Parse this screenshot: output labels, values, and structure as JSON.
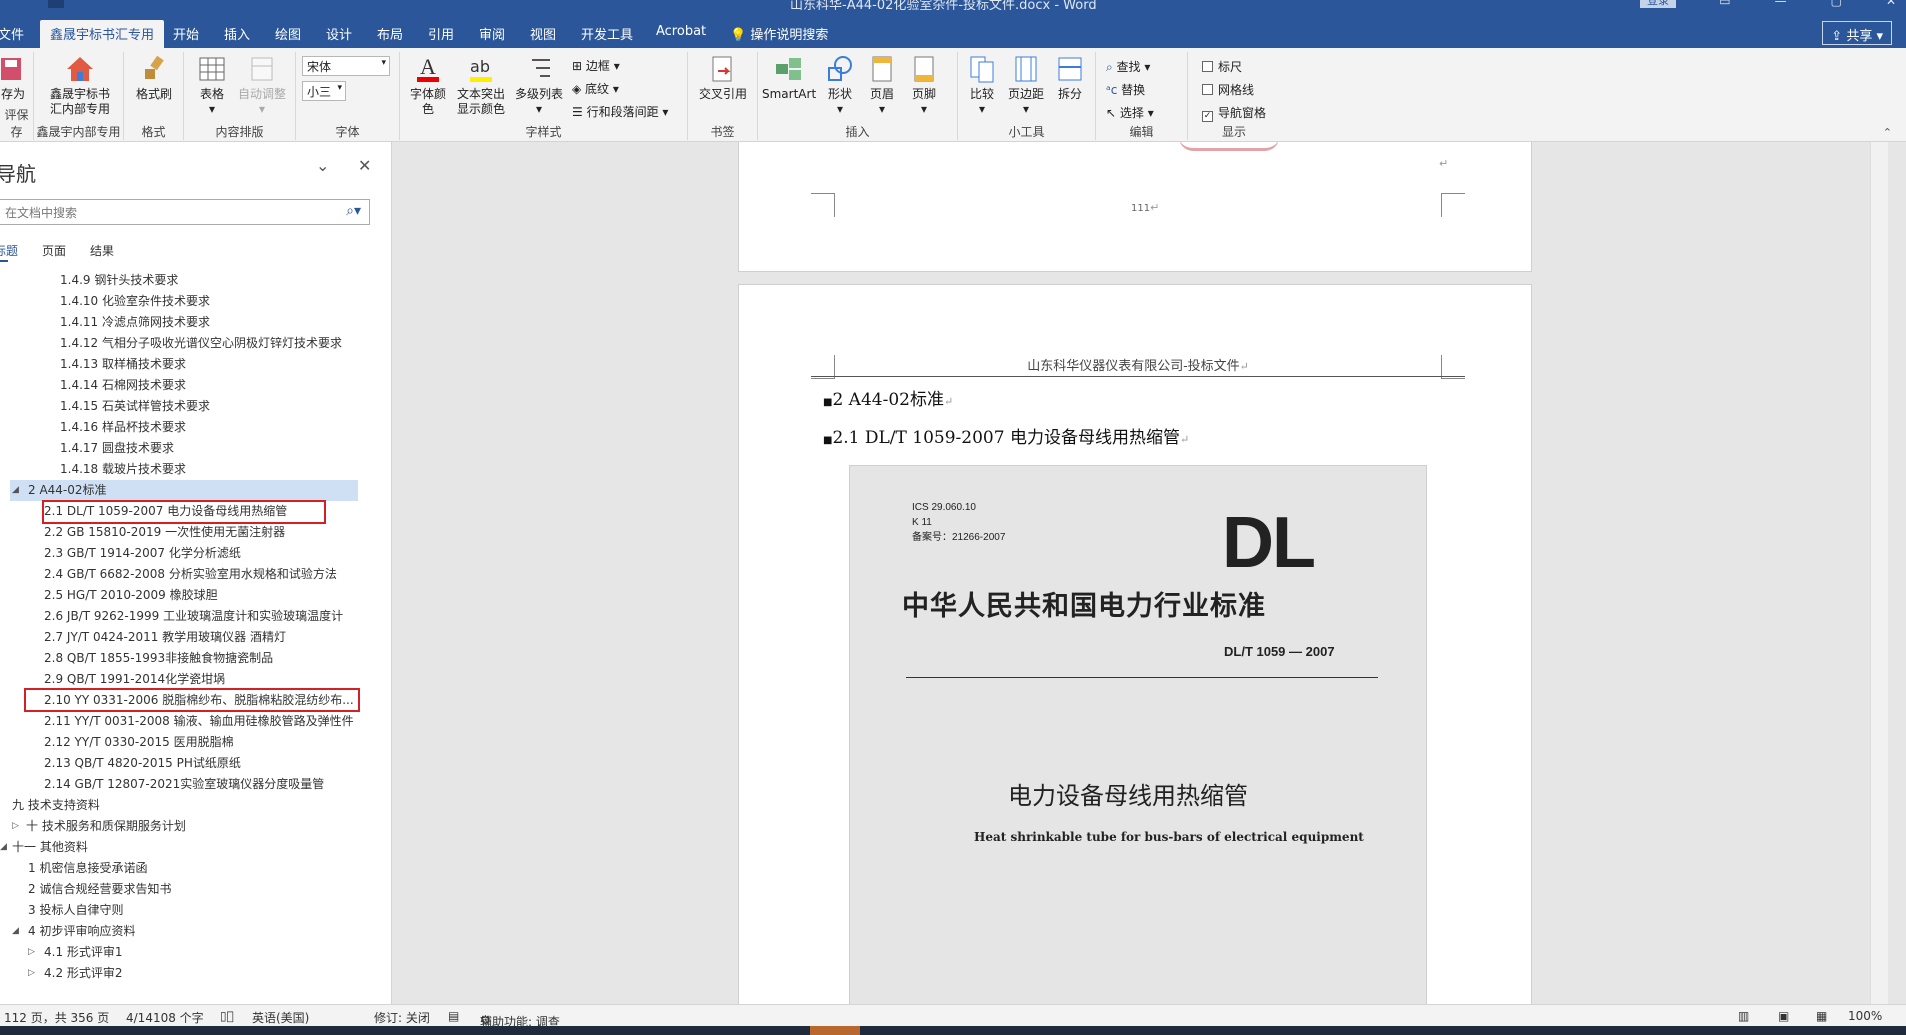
{
  "window": {
    "doc_title": "山东科华-A44-02化验室杂件-投标文件.docx  -  Word",
    "login": "登录",
    "share": "共享"
  },
  "tabs": [
    "文件",
    "鑫晟宇标书汇专用",
    "开始",
    "插入",
    "绘图",
    "设计",
    "布局",
    "引用",
    "审阅",
    "视图",
    "开发工具",
    "Acrobat",
    "操作说明搜索"
  ],
  "ribbon": {
    "save_as": "存为",
    "save_group": "评保存",
    "xsy_btn": "鑫晟宇标书汇内部专用",
    "xsy_group": "鑫晟宇内部专用",
    "format_painter": "格式刷",
    "format_group": "格式",
    "table": "表格",
    "autofit": "自动调整",
    "content_group": "内容排版",
    "font_name": "宋体",
    "font_size": "小三",
    "font_group": "字体",
    "font_color": "字体颜色",
    "highlight": "文本突出显示颜色",
    "multilevel": "多级列表",
    "border": "边框",
    "shading": "底纹",
    "line_spacing": "行和段落间距",
    "style_group": "字样式",
    "crossref": "交叉引用",
    "bookmark_group": "书签",
    "smartart": "SmartArt",
    "shape": "形状",
    "header": "页眉",
    "footer": "页脚",
    "insert_group": "插入",
    "compare": "比较",
    "margins": "页边距",
    "split": "拆分",
    "tools_group": "小工具",
    "find": "查找",
    "replace": "替换",
    "select": "选择",
    "edit_group": "编辑",
    "ruler": "标尺",
    "gridlines": "网格线",
    "navpane": "导航窗格",
    "show_group": "显示"
  },
  "nav": {
    "title": "导航",
    "search_placeholder": "在文档中搜索",
    "tabs": [
      "标题",
      "页面",
      "结果"
    ],
    "items": [
      "1.4.9 钢针头技术要求",
      "1.4.10 化验室杂件技术要求",
      "1.4.11 冷滤点筛网技术要求",
      "1.4.12 气相分子吸收光谱仪空心阴极灯锌灯技术要求",
      "1.4.13 取样桶技术要求",
      "1.4.14 石棉网技术要求",
      "1.4.15 石英试样管技术要求",
      "1.4.16 样品杯技术要求",
      "1.4.17 圆盘技术要求",
      "1.4.18 载玻片技术要求",
      "2 A44-02标准",
      "2.1 DL/T 1059-2007 电力设备母线用热缩管",
      "2.2 GB 15810-2019 一次性使用无菌注射器",
      "2.3 GB/T 1914-2007 化学分析滤纸",
      "2.4 GB/T 6682-2008 分析实验室用水规格和试验方法",
      "2.5 HG/T 2010-2009 橡胶球胆",
      "2.6 JB/T 9262-1999 工业玻璃温度计和实验玻璃温度计",
      "2.7 JY/T 0424-2011 教学用玻璃仪器 酒精灯",
      "2.8 QB/T 1855-1993非接触食物搪瓷制品",
      "2.9 QB/T 1991-2014化学瓷坩埚",
      "2.10 YY 0331-2006 脱脂棉纱布、脱脂棉粘胶混纺纱布...",
      "2.11 YY/T 0031-2008 输液、输血用硅橡胶管路及弹性件",
      "2.12 YY/T 0330-2015 医用脱脂棉",
      "2.13 QB/T 4820-2015 PH试纸原纸",
      "2.14 GB/T 12807-2021实验室玻璃仪器分度吸量管",
      "九 技术支持资料",
      "十 技术服务和质保期服务计划",
      "十一 其他资料",
      "1 机密信息接受承诺函",
      "2 诚信合规经营要求告知书",
      "3 投标人自律守则",
      "4 初步评审响应资料",
      "4.1 形式评审1",
      "4.2 形式评审2"
    ]
  },
  "document": {
    "page_number": "111",
    "header_text": "山东科华仪器仪表有限公司-投标文件",
    "heading1": "2 A44-02标准",
    "heading2": "2.1 DL/T  1059-2007  电力设备母线用热缩管",
    "scan": {
      "ics": "ICS 29.060.10",
      "k": "K 11",
      "record": "备案号：21266-2007",
      "logo": "DL",
      "standard_title": "中华人民共和国电力行业标准",
      "code": "DL/T  1059 — 2007",
      "cn_title": "电力设备母线用热缩管",
      "en_title": "Heat shrinkable tube for bus-bars of electrical equipment"
    }
  },
  "status": {
    "page": "112 页，共 356 页",
    "words": "4/14108 个字",
    "language": "英语(美国)",
    "track": "修订: 关闭",
    "accessibility": "辅助功能: 调查",
    "zoom": "100%"
  }
}
